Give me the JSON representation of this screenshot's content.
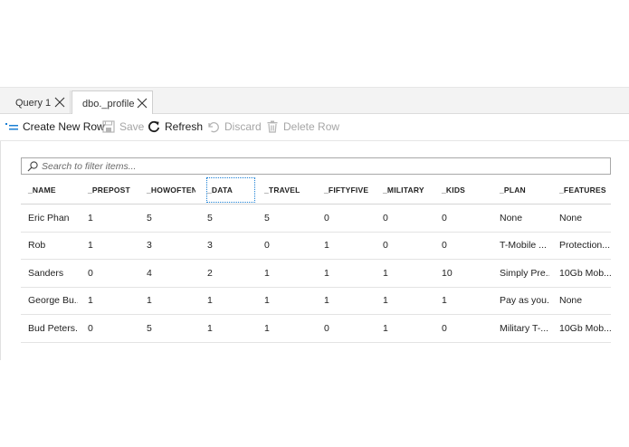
{
  "tabs": [
    {
      "label": "Query 1"
    },
    {
      "label": "dbo._profile"
    }
  ],
  "toolbar": {
    "create_label": "Create New Row",
    "save_label": "Save",
    "refresh_label": "Refresh",
    "discard_label": "Discard",
    "delete_label": "Delete Row"
  },
  "search": {
    "placeholder": "Search to filter items..."
  },
  "table": {
    "headers": [
      "_NAME",
      "_PREPOST",
      "_HOWOFTEN",
      "_DATA",
      "_TRAVEL",
      "_FIFTYFIVE",
      "_MILITARY",
      "_KIDS",
      "_PLAN",
      "_FEATURES"
    ],
    "rows": [
      [
        "Eric Phan",
        "1",
        "5",
        "5",
        "5",
        "0",
        "0",
        "0",
        "None",
        "None"
      ],
      [
        "Rob",
        "1",
        "3",
        "3",
        "0",
        "1",
        "0",
        "0",
        "T-Mobile ...",
        "Protection..."
      ],
      [
        "Sanders",
        "0",
        "4",
        "2",
        "1",
        "1",
        "1",
        "10",
        "Simply Pre...",
        "10Gb Mob..."
      ],
      [
        "George Bu...",
        "1",
        "1",
        "1",
        "1",
        "1",
        "1",
        "1",
        "Pay as you...",
        "None"
      ],
      [
        "Bud Peters...",
        "0",
        "5",
        "1",
        "1",
        "0",
        "1",
        "0",
        "Military T-...",
        "10Gb Mob..."
      ]
    ]
  },
  "colors": {
    "accent": "#1a7fd4",
    "disabled_text": "#a6a6a6",
    "tabbar_bg": "#f3f3f3"
  },
  "icons": {
    "create": "new-row-icon",
    "save": "save-icon",
    "refresh": "refresh-icon",
    "discard": "undo-icon",
    "delete": "trash-icon",
    "search": "search-icon",
    "close": "close-icon"
  }
}
